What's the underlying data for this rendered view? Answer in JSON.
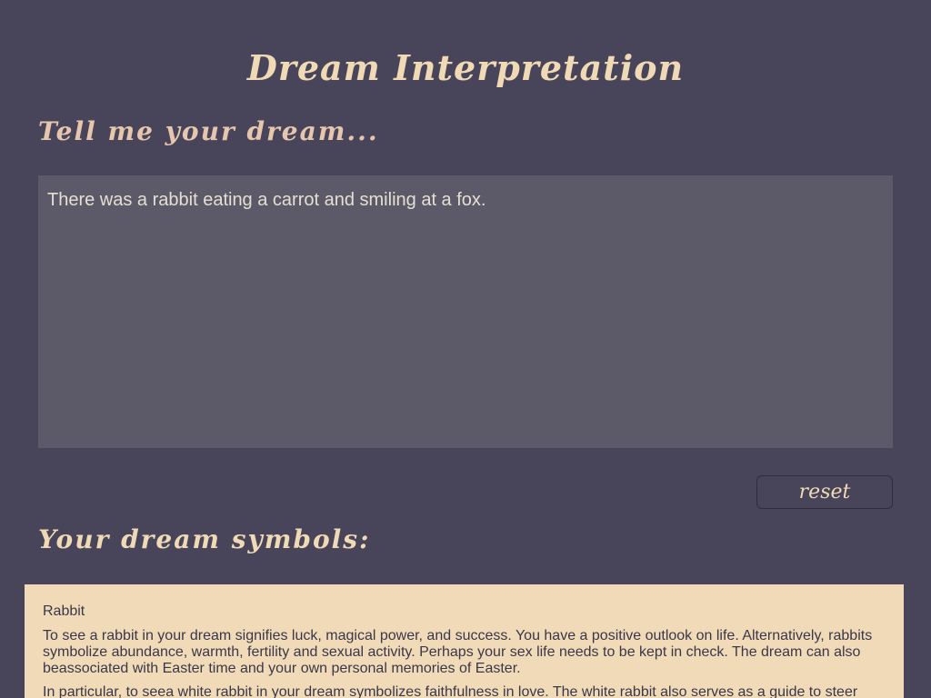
{
  "header": {
    "title": "Dream Interpretation"
  },
  "prompt": {
    "heading": "Tell me your dream...",
    "input_value": "There was a rabbit eating a carrot and smiling at a fox."
  },
  "controls": {
    "reset_label": "reset"
  },
  "symbols": {
    "heading": "Your dream symbols:",
    "items": [
      {
        "name": "Rabbit",
        "paragraphs": [
          "To see a rabbit in your dream signifies luck, magical power, and success. You have a positive outlook on life. Alternatively, rabbits symbolize abundance, warmth, fertility and sexual activity. Perhaps your sex life needs to be kept in check. The dream can also beassociated with Easter time and your own personal memories of Easter.",
          "In particular, to seea white rabbit in your dream symbolizes faithfulness in love. The white rabbit also serves as a guide to steer"
        ]
      }
    ]
  },
  "colors": {
    "background": "#48455b",
    "accent": "#f0d9b5",
    "input_background": "#5c5a69",
    "panel_background": "#f0dab8"
  }
}
